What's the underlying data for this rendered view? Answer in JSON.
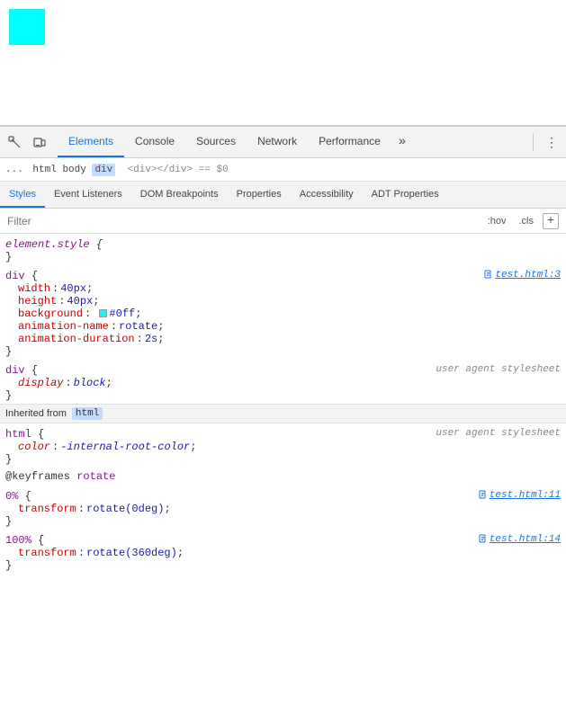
{
  "preview": {
    "cyan_box_color": "#00ffff"
  },
  "toolbar": {
    "inspect_icon": "⊹",
    "device_icon": "⬜",
    "tabs": [
      {
        "label": "Elements",
        "active": true
      },
      {
        "label": "Console",
        "active": false
      },
      {
        "label": "Sources",
        "active": false
      },
      {
        "label": "Network",
        "active": false
      },
      {
        "label": "Performance",
        "active": false
      }
    ],
    "overflow_label": "»",
    "more_label": "⋮"
  },
  "breadcrumb": {
    "text": "...",
    "html_tag": "html",
    "body_tag": "body",
    "div_tag": "div",
    "dom_text": "<div></div> == $0"
  },
  "panel_tabs": [
    {
      "label": "Styles",
      "active": true
    },
    {
      "label": "Event Listeners",
      "active": false
    },
    {
      "label": "DOM Breakpoints",
      "active": false
    },
    {
      "label": "Properties",
      "active": false
    },
    {
      "label": "Accessibility",
      "active": false
    },
    {
      "label": "ADT Properties",
      "active": false
    }
  ],
  "filter": {
    "placeholder": "Filter",
    "hov_badge": ":hov",
    "cls_badge": ".cls",
    "add_icon": "+"
  },
  "css_rules": [
    {
      "id": "element_style",
      "selector": "element.style",
      "selector_type": "element",
      "file_link": null,
      "properties": [],
      "closing_brace": true
    },
    {
      "id": "div_rule",
      "selector": "div",
      "file_link": "test.html:3",
      "properties": [
        {
          "name": "width",
          "value": "40px",
          "has_swatch": false
        },
        {
          "name": "height",
          "value": "40px",
          "has_swatch": false
        },
        {
          "name": "background",
          "value": "#0ff",
          "has_swatch": true,
          "swatch_color": "#00ffff"
        },
        {
          "name": "animation-name",
          "value": "rotate",
          "has_swatch": false
        },
        {
          "name": "animation-duration",
          "value": "2s",
          "has_swatch": false
        }
      ]
    },
    {
      "id": "div_ua_rule",
      "selector": "div",
      "file_link": null,
      "is_user_agent": true,
      "properties": [
        {
          "name": "display",
          "value": "block",
          "has_swatch": false,
          "italic": true
        }
      ]
    }
  ],
  "inherited_section": {
    "label": "Inherited from",
    "tag": "html"
  },
  "inherited_rules": [
    {
      "id": "html_ua_rule",
      "selector": "html",
      "file_link": null,
      "is_user_agent": true,
      "properties": [
        {
          "name": "color",
          "value": "-internal-root-color",
          "has_swatch": false,
          "italic": true
        }
      ]
    }
  ],
  "keyframes": [
    {
      "name": "rotate",
      "stops": [
        {
          "selector": "0%",
          "file_link": "test.html:11",
          "properties": [
            {
              "name": "transform",
              "value": "rotate(0deg)",
              "has_swatch": false
            }
          ]
        },
        {
          "selector": "100%",
          "file_link": "test.html:14",
          "properties": [
            {
              "name": "transform",
              "value": "rotate(360deg)",
              "has_swatch": false
            }
          ]
        }
      ]
    }
  ]
}
